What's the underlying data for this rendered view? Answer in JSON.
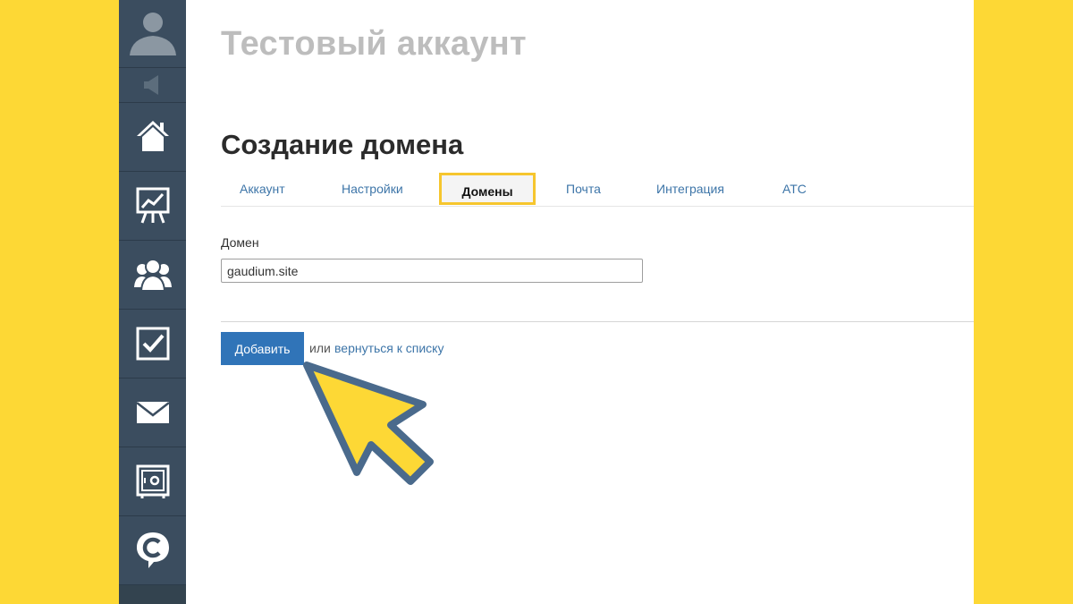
{
  "colors": {
    "background": "#fdd835",
    "sidebar": "#3b4d5f",
    "accent_blue": "#3074b8",
    "link_blue": "#3d75a8",
    "tab_highlight": "#f6c62e",
    "pointer_fill": "#fdd835",
    "pointer_stroke": "#4a6a8c"
  },
  "sidebar": {
    "avatar_icon": "user-silhouette-icon",
    "speaker_icon": "speaker-icon",
    "items": [
      {
        "icon": "home-icon"
      },
      {
        "icon": "chart-board-icon"
      },
      {
        "icon": "users-group-icon"
      },
      {
        "icon": "checkbox-icon"
      },
      {
        "icon": "envelope-icon"
      },
      {
        "icon": "safe-icon"
      },
      {
        "icon": "chat-c-icon"
      }
    ]
  },
  "header": {
    "account_title": "Тестовый аккаунт"
  },
  "page": {
    "title": "Создание домена"
  },
  "tabs": [
    {
      "label": "Аккаунт"
    },
    {
      "label": "Настройки"
    },
    {
      "label": "Домены",
      "active": true
    },
    {
      "label": "Почта"
    },
    {
      "label": "Интеграция"
    },
    {
      "label": "АТС"
    }
  ],
  "form": {
    "domain_label": "Домен",
    "domain_value": "gaudium.site"
  },
  "actions": {
    "add_label": "Добавить",
    "or_text": "или",
    "back_link": "вернуться к списку"
  }
}
